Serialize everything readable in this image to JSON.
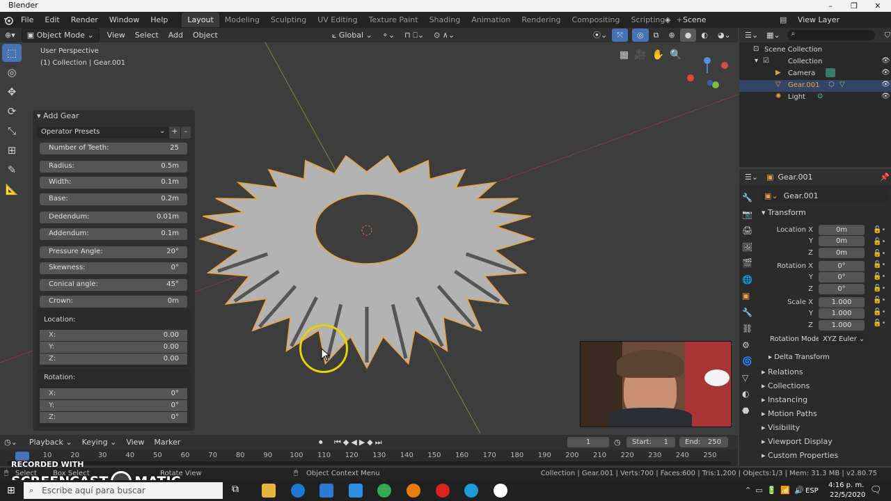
{
  "window": {
    "title": "Blender",
    "controls": [
      "–",
      "❐",
      "✕"
    ]
  },
  "menu": {
    "items": [
      "File",
      "Edit",
      "Render",
      "Window",
      "Help"
    ]
  },
  "workspaces": {
    "tabs": [
      "Layout",
      "Modeling",
      "Sculpting",
      "UV Editing",
      "Texture Paint",
      "Shading",
      "Animation",
      "Rendering",
      "Compositing",
      "Scripting"
    ],
    "add": "+"
  },
  "scene": {
    "label": "Scene",
    "view_layer": "View Layer"
  },
  "viewport_header": {
    "mode": "Object Mode",
    "menus": [
      "View",
      "Select",
      "Add",
      "Object"
    ],
    "orientation": "Global"
  },
  "viewport": {
    "perspective": "User Perspective",
    "collection_info": "(1) Collection | Gear.001"
  },
  "gear_panel": {
    "title": "Add Gear",
    "presets_label": "Operator Presets",
    "params": [
      {
        "label": "Number of Teeth:",
        "value": "25"
      },
      {
        "label": "Radius:",
        "value": "0.5m"
      },
      {
        "label": "Width:",
        "value": "0.1m"
      },
      {
        "label": "Base:",
        "value": "0.2m"
      },
      {
        "label": "Dedendum:",
        "value": "0.01m"
      },
      {
        "label": "Addendum:",
        "value": "0.1m"
      },
      {
        "label": "Pressure Angle:",
        "value": "20°"
      },
      {
        "label": "Skewness:",
        "value": "0°"
      },
      {
        "label": "Conical angle:",
        "value": "45°"
      },
      {
        "label": "Crown:",
        "value": "0m"
      }
    ],
    "location_label": "Location:",
    "location": [
      {
        "axis": "X:",
        "value": "0.00"
      },
      {
        "axis": "Y:",
        "value": "0.00"
      },
      {
        "axis": "Z:",
        "value": "0.00"
      }
    ],
    "rotation_label": "Rotation:",
    "rotation": [
      {
        "axis": "X:",
        "value": "0°"
      },
      {
        "axis": "Y:",
        "value": "0°"
      },
      {
        "axis": "Z:",
        "value": "0°"
      }
    ]
  },
  "outliner": {
    "root": "Scene Collection",
    "items": [
      {
        "name": "Collection"
      },
      {
        "name": "Camera"
      },
      {
        "name": "Gear.001"
      },
      {
        "name": "Light"
      }
    ]
  },
  "properties": {
    "object_name": "Gear.001",
    "data_name": "Gear.001",
    "transform_label": "Transform",
    "location_label": "Location X",
    "location": [
      "0m",
      "0m",
      "0m"
    ],
    "rotation_label": "Rotation X",
    "rotation": [
      "0°",
      "0°",
      "0°"
    ],
    "scale_label": "Scale X",
    "scale": [
      "1.000",
      "1.000",
      "1.000"
    ],
    "axis_y": "Y",
    "axis_z": "Z",
    "rotation_mode_label": "Rotation Mode",
    "rotation_mode": "XYZ Euler",
    "delta": "Delta Transform",
    "sections": [
      "Relations",
      "Collections",
      "Instancing",
      "Motion Paths",
      "Visibility",
      "Viewport Display",
      "Custom Properties"
    ]
  },
  "timeline": {
    "menus": [
      "Playback",
      "Keying",
      "View",
      "Marker"
    ],
    "current_frame": "1",
    "start_label": "Start:",
    "start": "1",
    "end_label": "End:",
    "end": "250",
    "ticks": [
      "1",
      "10",
      "20",
      "30",
      "40",
      "50",
      "60",
      "70",
      "80",
      "90",
      "100",
      "110",
      "120",
      "130",
      "140",
      "150",
      "160",
      "170",
      "180",
      "190",
      "200",
      "210",
      "220",
      "230",
      "240",
      "250"
    ]
  },
  "status": {
    "select": "Select",
    "box_select": "Box Select",
    "rotate_view": "Rotate View",
    "context_menu": "Object Context Menu",
    "stats": "Collection | Gear.001 | Verts:700 | Faces:600 | Tris:1,200 | Objects:1/3 | Mem: 31.3 MB | v2.80.75"
  },
  "watermark": {
    "line1": "RECORDED WITH",
    "line2": "SCREENCAST",
    "line3": "MATIC"
  },
  "taskbar": {
    "search_placeholder": "Escribe aquí para buscar",
    "lang": "ESP",
    "time": "4:16 p. m.",
    "date": "22/5/2020"
  },
  "colors": {
    "accent": "#4772b3",
    "selected": "#f0a23a",
    "gear": "#b3b3b3"
  }
}
